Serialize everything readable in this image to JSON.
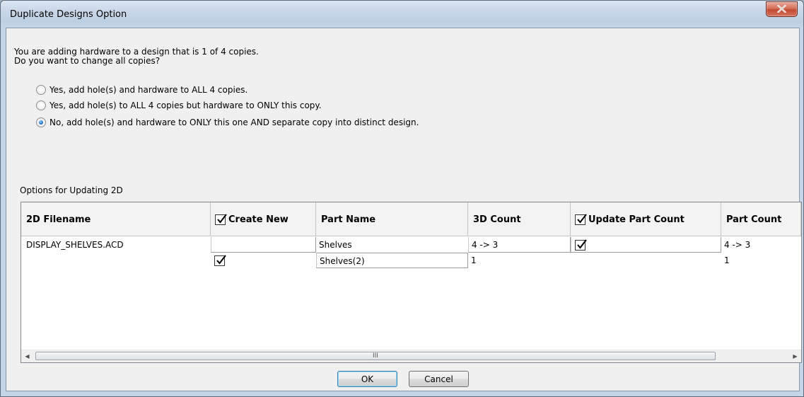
{
  "window": {
    "title": "Duplicate Designs Option"
  },
  "prompt": {
    "line1": "You are adding hardware to a design that is 1 of 4 copies.",
    "line2": "Do you want to change all copies?"
  },
  "options": [
    {
      "label": "Yes, add hole(s) and hardware to ALL 4 copies.",
      "selected": false
    },
    {
      "label": "Yes, add hole(s) to ALL 4 copies but hardware to ONLY this copy.",
      "selected": false
    },
    {
      "label": "No, add hole(s) and hardware to ONLY this one AND separate copy into distinct design.",
      "selected": true
    }
  ],
  "grid": {
    "section_label": "Options for Updating 2D",
    "columns": [
      {
        "label": "2D Filename",
        "checkbox": false
      },
      {
        "label": "Create New",
        "checkbox": true,
        "checked": true
      },
      {
        "label": "Part Name",
        "checkbox": false
      },
      {
        "label": "3D Count",
        "checkbox": false
      },
      {
        "label": "Update Part Count",
        "checkbox": true,
        "checked": true
      },
      {
        "label": "Part Count",
        "checkbox": false
      }
    ],
    "rows": [
      {
        "filename": "DISPLAY_SHELVES.ACD",
        "create_new": false,
        "part_name": "Shelves",
        "count_3d": "4 -> 3",
        "update_part_count": true,
        "part_count": "4 -> 3"
      },
      {
        "filename": "",
        "create_new": true,
        "part_name": "Shelves(2)",
        "count_3d": "1",
        "update_part_count": false,
        "part_count": "1"
      }
    ],
    "scroll_grip": "III",
    "scroll_left": "◀",
    "scroll_right": "▶"
  },
  "buttons": {
    "ok": "OK",
    "cancel": "Cancel"
  }
}
